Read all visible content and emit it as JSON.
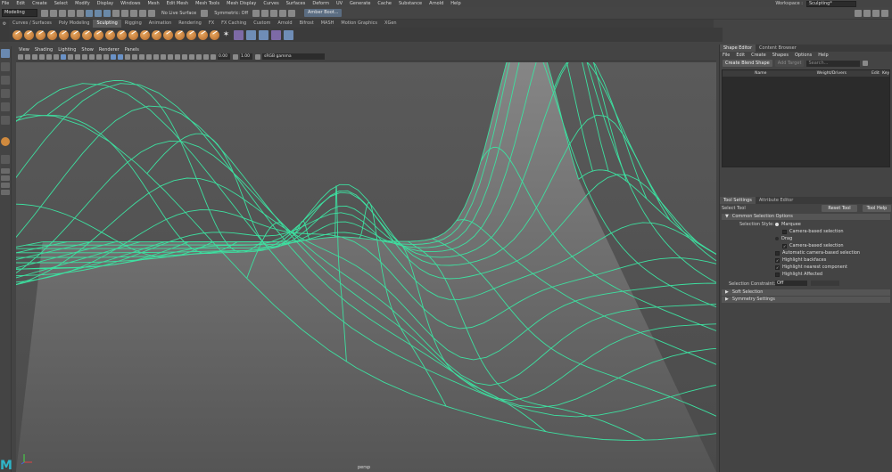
{
  "menubar": {
    "items": [
      "File",
      "Edit",
      "Create",
      "Select",
      "Modify",
      "Display",
      "Windows",
      "Mesh",
      "Edit Mesh",
      "Mesh Tools",
      "Mesh Display",
      "Curves",
      "Surfaces",
      "Deform",
      "UV",
      "Generate",
      "Cache",
      "Substance",
      "Arnold",
      "Help"
    ],
    "workspace_label": "Workspace :",
    "workspace_value": "Sculpting*"
  },
  "statusline": {
    "mode": "Modeling",
    "live_surface": "No Live Surface",
    "symmetric": "Symmetric: Off",
    "user": "Amber Boot..."
  },
  "shelf": {
    "tabs": [
      "Curves / Surfaces",
      "Poly Modeling",
      "Sculpting",
      "Rigging",
      "Animation",
      "Rendering",
      "FX",
      "FX Caching",
      "Custom",
      "Arnold",
      "Bifrost",
      "MASH",
      "Motion Graphics",
      "XGen"
    ],
    "active_tab": "Sculpting"
  },
  "viewport": {
    "menu": [
      "View",
      "Shading",
      "Lighting",
      "Show",
      "Renderer",
      "Panels"
    ],
    "exposure": "0.00",
    "gamma": "1.00",
    "colorspace": "sRGB gamma",
    "camera": "persp",
    "colors": {
      "wire": "#3de0a0",
      "bg_top": "#5a5a5a",
      "bg_bottom": "#4a4a4a"
    }
  },
  "shape_editor": {
    "tabs": [
      "Shape Editor",
      "Content Browser"
    ],
    "menu": [
      "File",
      "Edit",
      "Create",
      "Shapes",
      "Options",
      "Help"
    ],
    "create_blend_shape": "Create Blend Shape",
    "add_target": "Add Target",
    "search_placeholder": "Search...",
    "columns": {
      "name": "Name",
      "weight": "Weight/Drivers",
      "edit": "Edit",
      "key": "Key"
    }
  },
  "tool_settings": {
    "tabs": [
      "Tool Settings",
      "Attribute Editor"
    ],
    "tool_name": "Select Tool",
    "reset_tool": "Reset Tool",
    "tool_help": "Tool Help",
    "section_common": "Common Selection Options",
    "selection_style_label": "Selection Style:",
    "marquee": "Marquee",
    "camera_based_selection_1": "Camera-based selection",
    "drag": "Drag",
    "camera_based_selection_2": "Camera-based selection",
    "auto_camera_based": "Automatic camera-based selection",
    "highlight_backfaces": "Highlight backfaces",
    "highlight_nearest": "Highlight nearest component",
    "highlight_affected": "Highlight Affected",
    "selection_constraint_label": "Selection Constraint:",
    "selection_constraint_value": "Off",
    "section_soft": "Soft Selection",
    "section_symmetry": "Symmetry Settings"
  }
}
